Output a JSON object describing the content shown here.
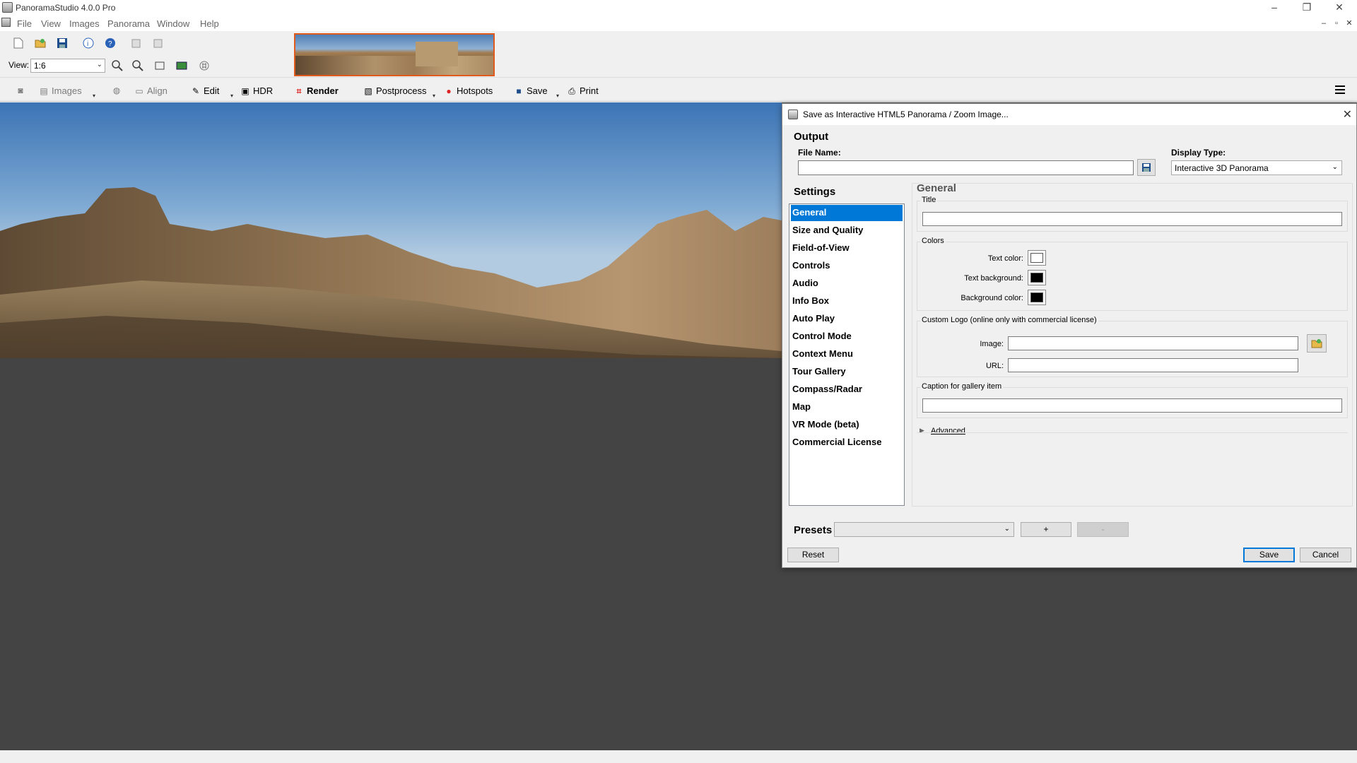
{
  "window": {
    "title": "PanoramaStudio 4.0.0 Pro",
    "minimize": "–",
    "restore": "❐",
    "close": "✕"
  },
  "menu": [
    "File",
    "View",
    "Images",
    "Panorama",
    "Window",
    "Help"
  ],
  "mdi": {
    "minimize": "–",
    "restore": "▫",
    "close": "✕"
  },
  "view": {
    "label": "View:",
    "value": "1:6"
  },
  "toolbar2": {
    "images": "Images",
    "align": "Align",
    "edit": "Edit",
    "hdr": "HDR",
    "render": "Render",
    "postprocess": "Postprocess",
    "hotspots": "Hotspots",
    "save": "Save",
    "print": "Print"
  },
  "dialog": {
    "title": "Save as Interactive HTML5 Panorama / Zoom Image...",
    "output_heading": "Output",
    "file_name_label": "File Name:",
    "file_name_value": "",
    "display_type_label": "Display Type:",
    "display_type_value": "Interactive 3D Panorama",
    "settings_heading": "Settings",
    "settings_items": [
      "General",
      "Size and Quality",
      "Field-of-View",
      "Controls",
      "Audio",
      "Info Box",
      "Auto Play",
      "Control Mode",
      "Context Menu",
      "Tour Gallery",
      "Compass/Radar",
      "Map",
      "VR Mode (beta)",
      "Commercial License"
    ],
    "selected_setting": "General",
    "panel": {
      "heading": "General",
      "title_group": "Title",
      "title_value": "",
      "colors_group": "Colors",
      "text_color_label": "Text color:",
      "text_color": "#ffffff",
      "text_background_label": "Text background:",
      "text_background": "#000000",
      "background_color_label": "Background color:",
      "background_color": "#000000",
      "logo_group": "Custom Logo (online only with commercial license)",
      "image_label": "Image:",
      "image_value": "",
      "url_label": "URL:",
      "url_value": "",
      "caption_group": "Caption for gallery item",
      "caption_value": "",
      "advanced_label": "Advanced"
    },
    "presets_label": "Presets",
    "presets_value": "",
    "add_preset": "+",
    "remove_preset": "-",
    "reset_button": "Reset",
    "save_button": "Save",
    "cancel_button": "Cancel"
  }
}
